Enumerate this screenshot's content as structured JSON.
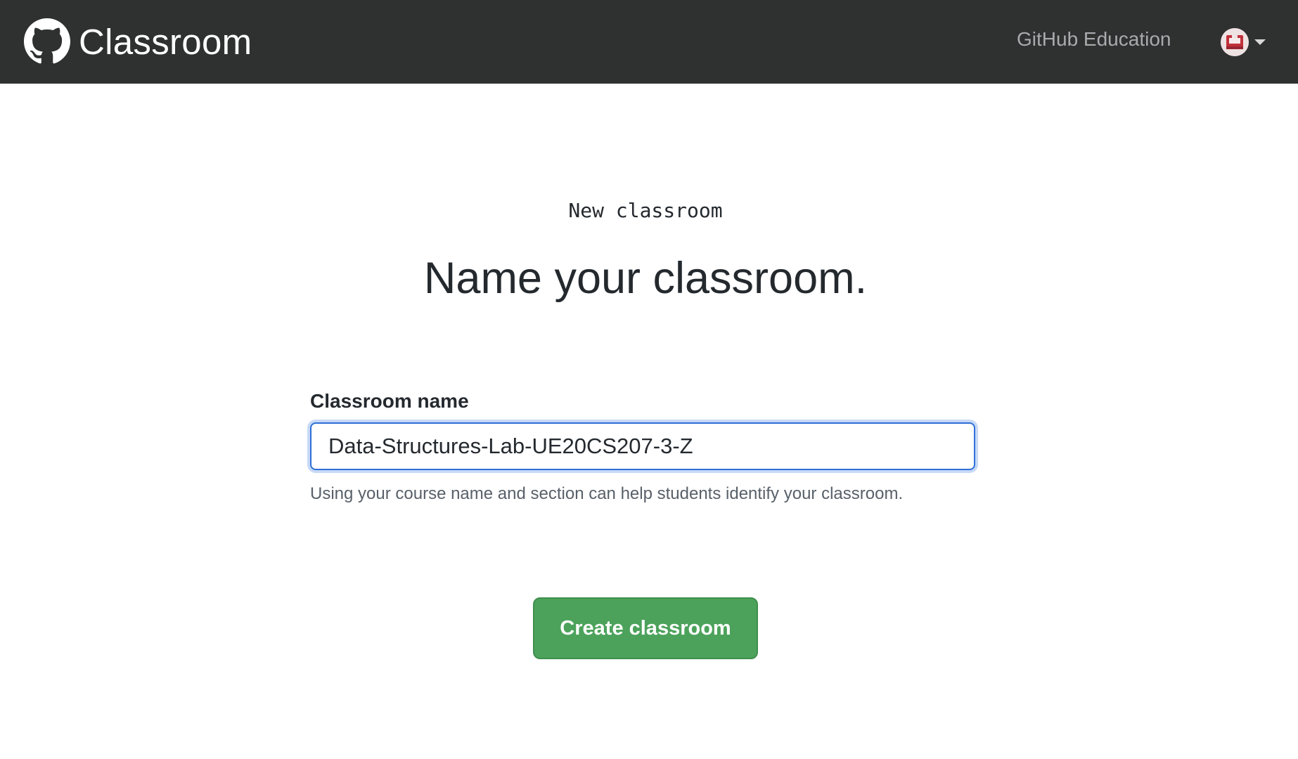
{
  "header": {
    "app_title": "Classroom",
    "logo_icon": "github-octocat-icon",
    "nav_link": "GitHub Education",
    "avatar_icon": "user-avatar-icon",
    "menu_caret_icon": "caret-down-icon"
  },
  "page": {
    "eyebrow": "New classroom",
    "title": "Name your classroom."
  },
  "form": {
    "label": "Classroom name",
    "value": "Data-Structures-Lab-UE20CS207-3-Z",
    "help": "Using your course name and section can help students identify your classroom.",
    "submit_label": "Create classroom"
  },
  "colors": {
    "header_bg": "#2f3131",
    "accent_focus": "#2e6fd6",
    "button_green": "#4ca25b"
  }
}
